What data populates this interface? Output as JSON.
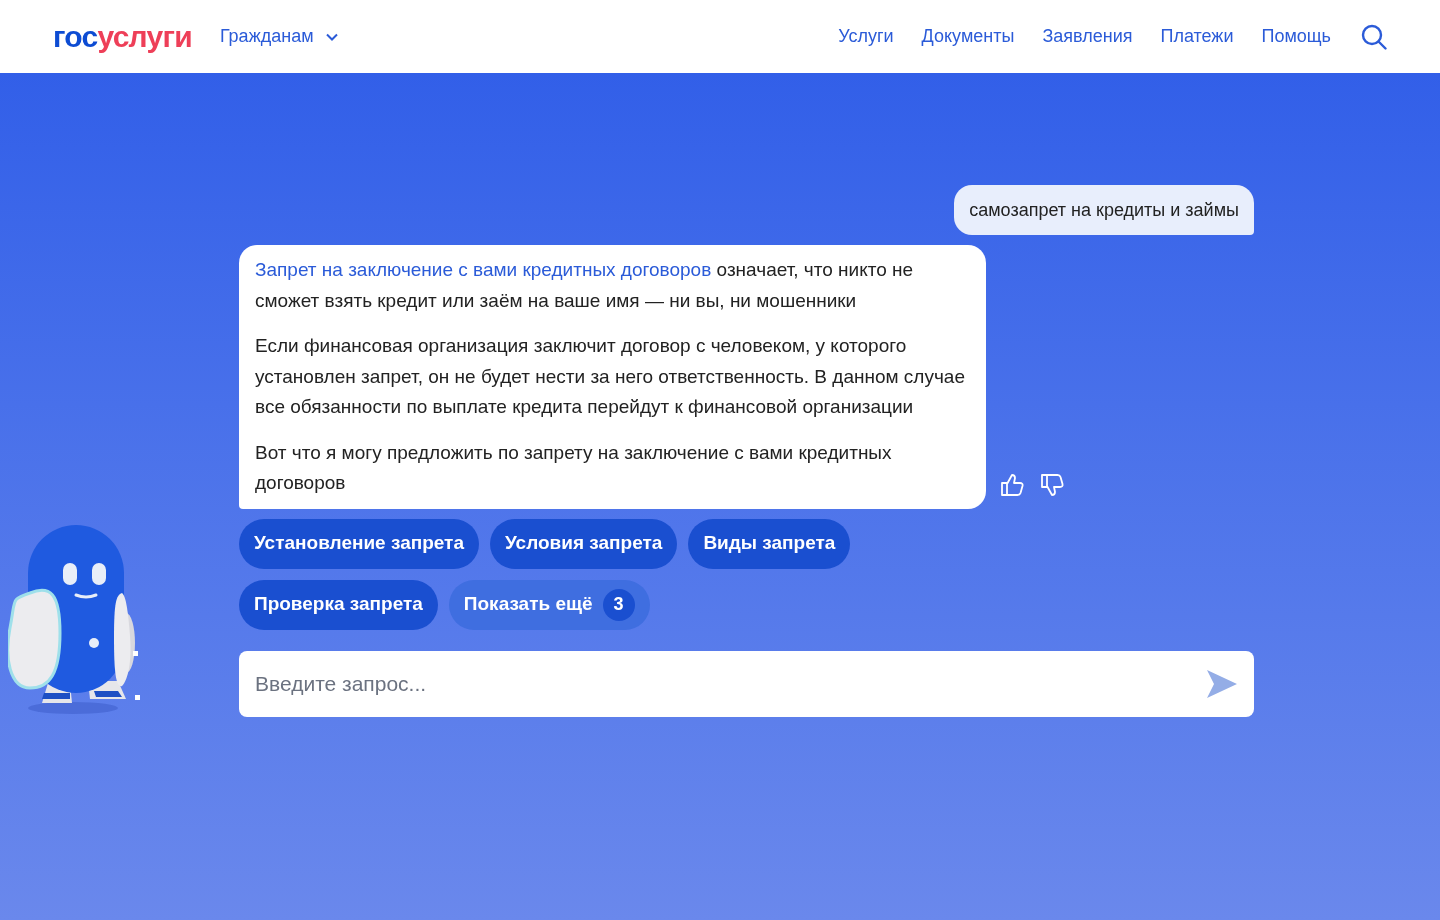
{
  "header": {
    "logo": {
      "part_1": "гос",
      "part_2": "услуги"
    },
    "audience_menu": {
      "label": "Гражданам",
      "expanded": false
    },
    "nav": [
      "Услуги",
      "Документы",
      "Заявления",
      "Платежи",
      "Помощь"
    ]
  },
  "chat": {
    "messages": [
      {
        "kind": "user",
        "text": "самозапрет на кредиты и займы"
      },
      {
        "kind": "bot",
        "paragraphs": [
          {
            "link": "Запрет на заключение с вами кредитных договоров",
            "text": " означает, что никто не сможет взять кредит или заём на ваше имя — ни вы, ни мошенники"
          },
          {
            "text": "Если финансовая организация заключит договор с человеком, у которого установлен запрет, он не будет нести за него ответственность. В данном случае все обязанности по выплате кредита перейдут к финансовой организации"
          },
          {
            "text": "Вот что я могу предложить по запрету на заключение с вами кредитных договоров"
          }
        ]
      }
    ],
    "suggestions": [
      {
        "kind": "topic",
        "label": "Установление запрета"
      },
      {
        "kind": "topic",
        "label": "Условия запрета"
      },
      {
        "kind": "topic",
        "label": "Виды запрета"
      },
      {
        "kind": "topic",
        "label": "Проверка запрета"
      },
      {
        "kind": "more",
        "label": "Показать ещё",
        "count": "3"
      }
    ],
    "input": {
      "placeholder": "Введите запрос..."
    }
  }
}
